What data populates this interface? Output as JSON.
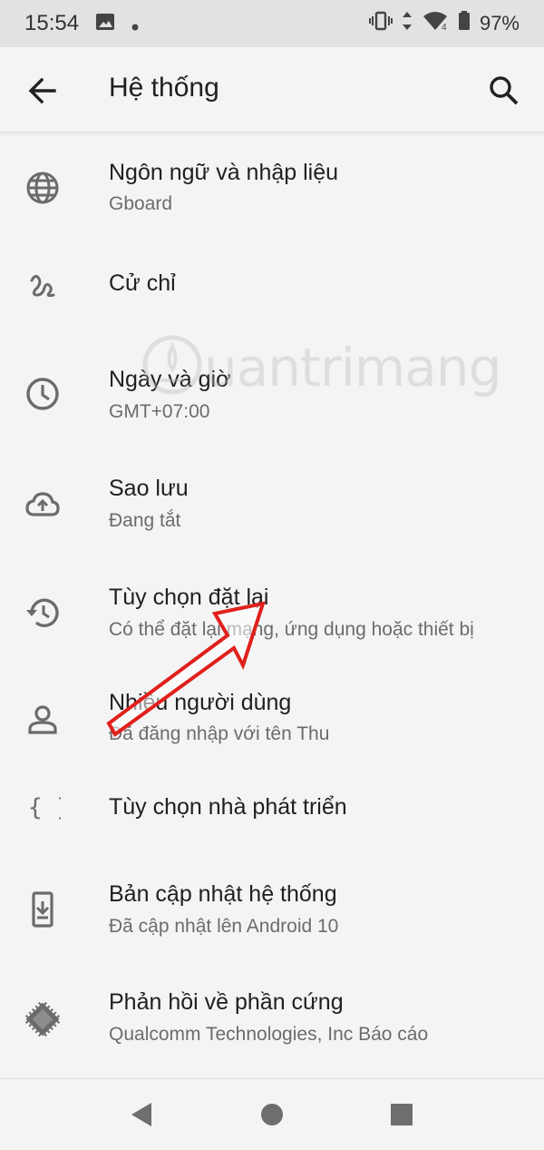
{
  "status_bar": {
    "time": "15:54",
    "battery": "97%",
    "network_label": "4"
  },
  "app_bar": {
    "title": "Hệ thống"
  },
  "items": [
    {
      "title": "Ngôn ngữ và nhập liệu",
      "subtitle": "Gboard",
      "icon": "globe-icon"
    },
    {
      "title": "Cử chỉ",
      "subtitle": "",
      "icon": "gesture-icon"
    },
    {
      "title": "Ngày và giờ",
      "subtitle": "GMT+07:00",
      "icon": "clock-icon"
    },
    {
      "title": "Sao lưu",
      "subtitle": "Đang tắt",
      "icon": "cloud-upload-icon"
    },
    {
      "title": "Tùy chọn đặt lại",
      "subtitle": "Có thể đặt lại mạng, ứng dụng hoặc thiết bị",
      "icon": "history-icon"
    },
    {
      "title": "Nhiều người dùng",
      "subtitle": "Đã đăng nhập với tên Thu",
      "icon": "person-icon"
    },
    {
      "title": "Tùy chọn nhà phát triển",
      "subtitle": "",
      "icon": "braces-icon"
    },
    {
      "title": "Bản cập nhật hệ thống",
      "subtitle": "Đã cập nhật lên Android 10",
      "icon": "system-update-icon"
    },
    {
      "title": "Phản hồi về phần cứng",
      "subtitle": "Qualcomm Technologies, Inc Báo cáo",
      "icon": "chip-icon"
    }
  ],
  "watermark": "uantrimang",
  "colors": {
    "status_bar_bg": "#e2e2e2",
    "background": "#f4f4f4",
    "icon": "#6b6b6b",
    "arrow": "#e0201b"
  }
}
